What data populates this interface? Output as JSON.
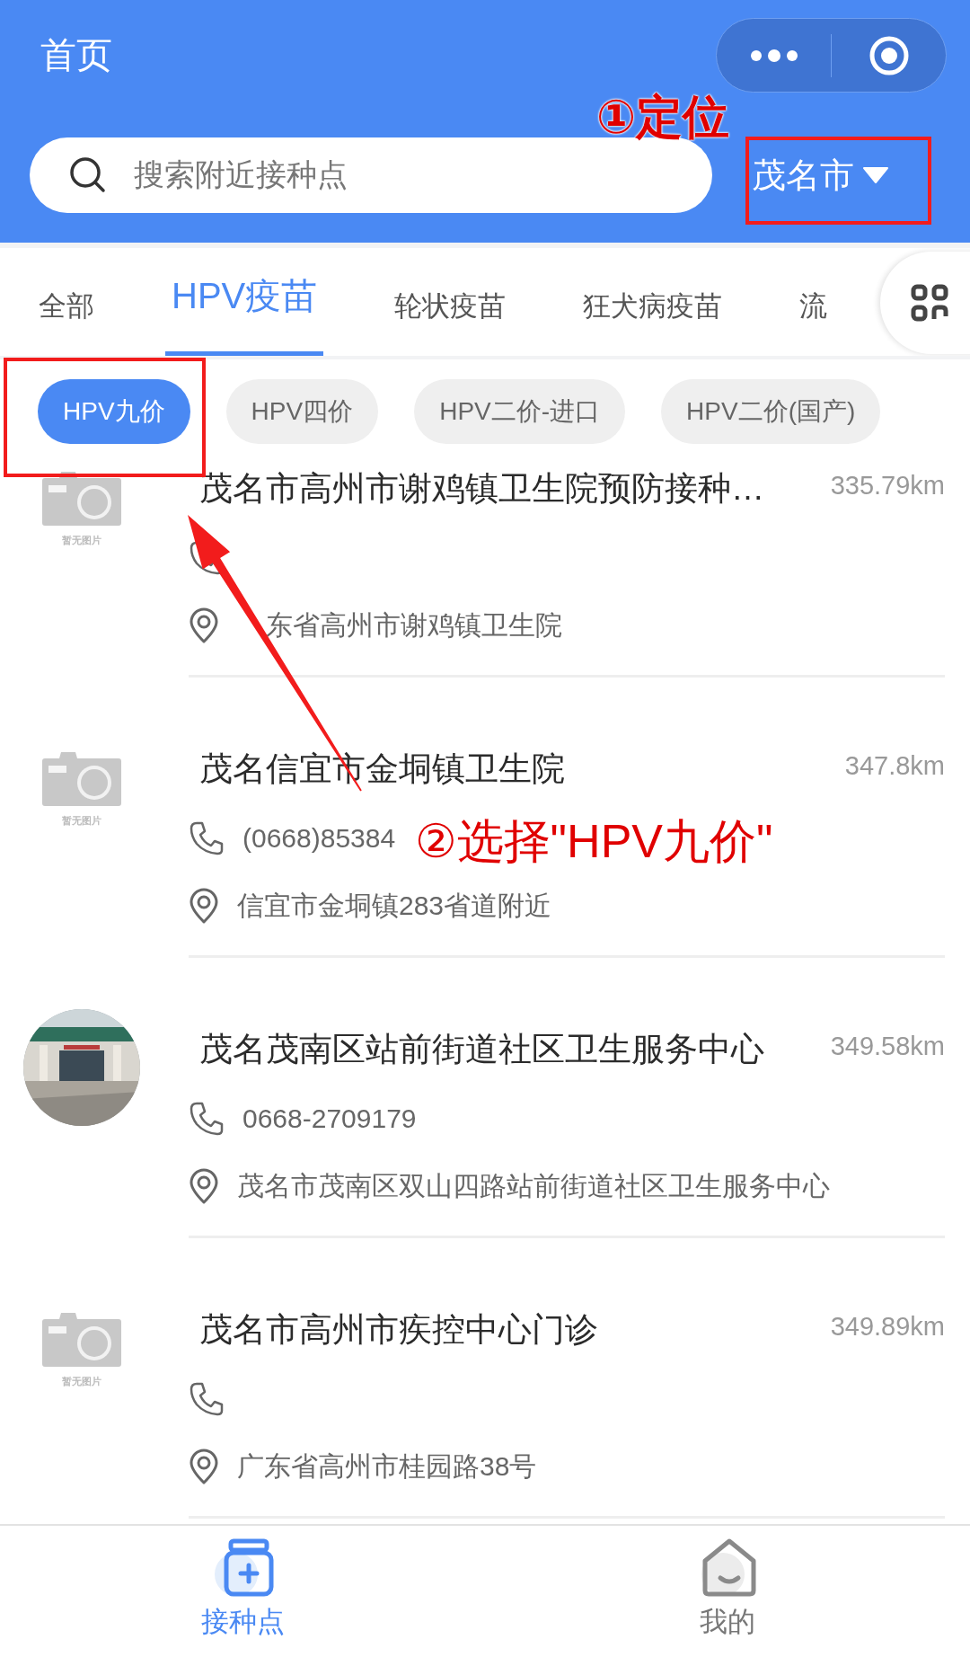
{
  "header": {
    "title": "首页"
  },
  "search": {
    "placeholder": "搜索附近接种点"
  },
  "city": {
    "label": "茂名市"
  },
  "tabs": [
    {
      "label": "全部",
      "selected": false
    },
    {
      "label": "HPV疫苗",
      "selected": true
    },
    {
      "label": "轮状疫苗",
      "selected": false
    },
    {
      "label": "狂犬病疫苗",
      "selected": false
    },
    {
      "label": "流",
      "selected": false
    }
  ],
  "chips": [
    {
      "label": "HPV九价",
      "selected": true
    },
    {
      "label": "HPV四价",
      "selected": false
    },
    {
      "label": "HPV二价-进口",
      "selected": false
    },
    {
      "label": "HPV二价(国产)",
      "selected": false
    }
  ],
  "sites": [
    {
      "name": "茂名市高州市谢鸡镇卫生院预防接种…",
      "distance": "335.79km",
      "address": "东省高州市谢鸡镇卫生院",
      "photo": {
        "kind": "placeholder",
        "caption": "暂无图片"
      }
    },
    {
      "name": "茂名信宜市金垌镇卫生院",
      "distance": "347.8km",
      "phone": "(0668)85384",
      "address": "信宜市金垌镇283省道附近",
      "photo": {
        "kind": "placeholder",
        "caption": "暂无图片"
      }
    },
    {
      "name": "茂名茂南区站前街道社区卫生服务中心",
      "distance": "349.58km",
      "phone": "0668-2709179",
      "address": "茂名市茂南区双山四路站前街道社区卫生服务中心"
    },
    {
      "name": "茂名市高州市疾控中心门诊",
      "distance": "349.89km",
      "address": "广东省高州市桂园路38号",
      "photo": {
        "kind": "placeholder",
        "caption": "暂无图片"
      }
    }
  ],
  "bottom_nav": [
    {
      "label": "接种点",
      "selected": true
    },
    {
      "label": "我的",
      "selected": false
    }
  ],
  "annotations": [
    {
      "text": "①定位"
    },
    {
      "text": "②选择\"HPV九价\""
    }
  ]
}
